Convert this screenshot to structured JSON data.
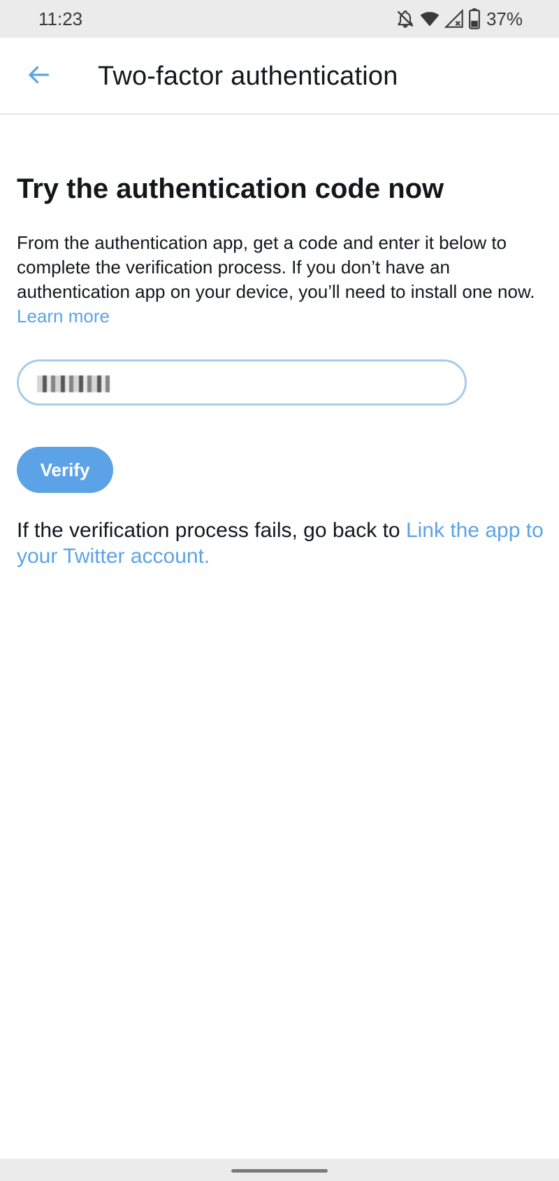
{
  "status_bar": {
    "time": "11:23",
    "battery_percent": "37%",
    "icons": [
      "notifications-off-icon",
      "wifi-icon",
      "signal-icon",
      "battery-icon"
    ]
  },
  "app_bar": {
    "back_icon": "arrow-left-icon",
    "title": "Two-factor authentication"
  },
  "main": {
    "heading": "Try the authentication code now",
    "description": "From the authentication app, get a code and enter it below to complete the verification process. If you don’t have an authentication app on your device, you’ll need to install one now.",
    "learn_more_label": "Learn more",
    "code_input": {
      "value": "",
      "obscured": true
    },
    "verify_label": "Verify",
    "fail_text": "If the verification process fails, go back to",
    "fail_link_label": "Link the app to your Twitter account."
  },
  "colors": {
    "accent": "#5ba3e6",
    "input_border": "#a7cbea",
    "text": "#14171a",
    "system_bar": "#ebebeb"
  }
}
